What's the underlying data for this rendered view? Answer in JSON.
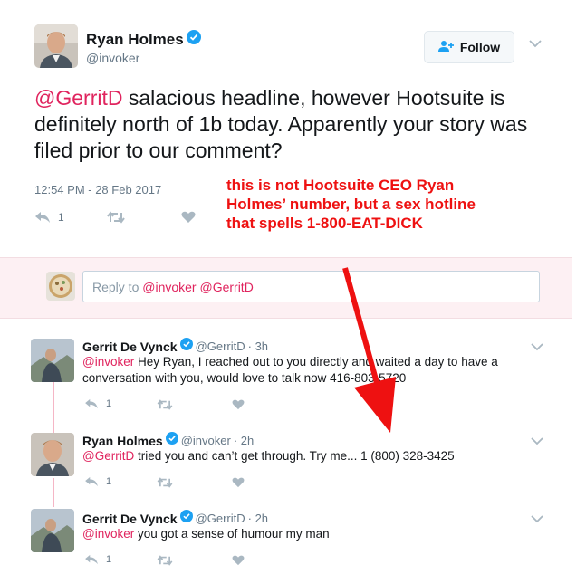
{
  "main_tweet": {
    "author_name": "Ryan Holmes",
    "author_handle": "@invoker",
    "follow_label": "Follow",
    "text_mention": "@GerritD",
    "text_body": " salacious headline, however Hootsuite is definitely north of 1b today. Apparently your story was filed prior to our comment?",
    "timestamp": "12:54 PM - 28 Feb 2017",
    "reply_count": "1"
  },
  "annotation": {
    "text": "this is not Hootsuite CEO Ryan Holmes’ number, but a sex hotline that spells 1-800-EAT-DICK"
  },
  "reply_box": {
    "prefix": "Reply to ",
    "mentions": "@invoker @GerritD"
  },
  "replies": [
    {
      "name": "Gerrit De Vynck",
      "handle": "@GerritD",
      "time": "· 3h",
      "mention": "@invoker",
      "text": " Hey Ryan, I reached out to you directly and waited a day to have a conversation with you, would love to talk now 416-803-5720",
      "reply_count": "1"
    },
    {
      "name": "Ryan Holmes",
      "handle": "@invoker",
      "time": "· 2h",
      "mention": "@GerritD",
      "text": " tried you and can’t get through. Try me... 1 (800) 328-3425",
      "reply_count": "1"
    },
    {
      "name": "Gerrit De Vynck",
      "handle": "@GerritD",
      "time": "· 2h",
      "mention": "@invoker",
      "text": " you got a sense of humour my man",
      "reply_count": "1"
    }
  ],
  "colors": {
    "mention": "#e0245e",
    "verified": "#1da1f2",
    "annotation": "#ee1111",
    "reply_area_bg": "#fdf0f3"
  }
}
